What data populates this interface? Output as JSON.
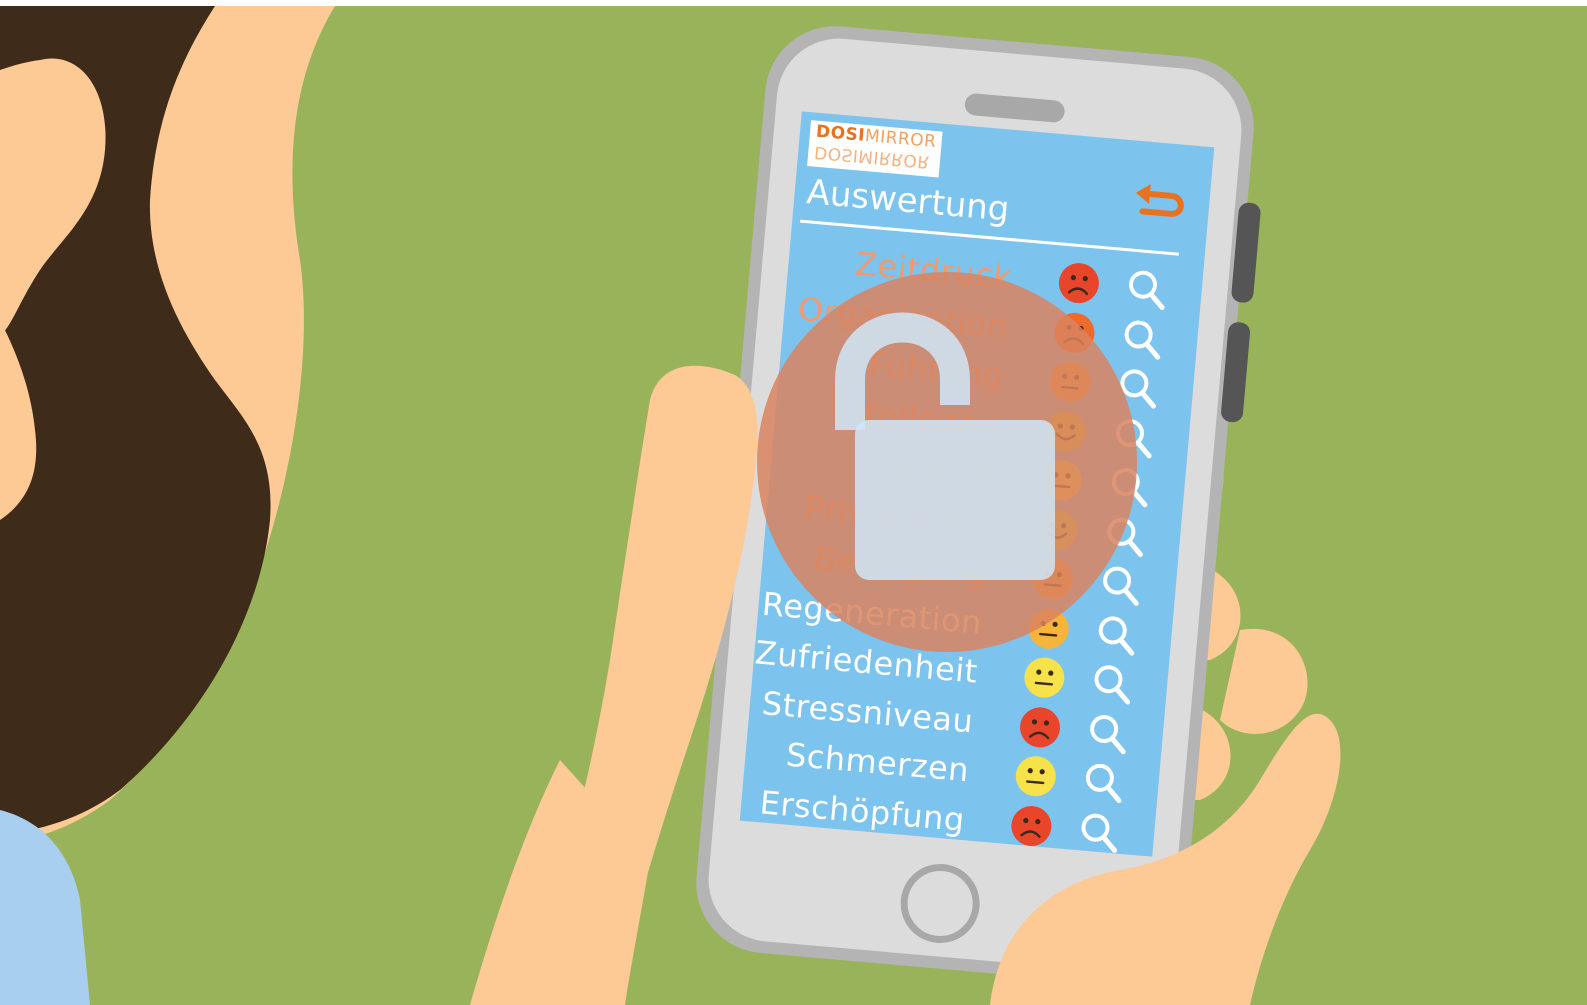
{
  "app": {
    "logo_top_bold": "DOSI",
    "logo_top_light": "MIRROR",
    "logo_bottom": "DOSIMIRROR",
    "title": "Auswertung",
    "back_icon": "undo-arrow-icon"
  },
  "colors": {
    "background_green": "#99b35a",
    "skin": "#fdc995",
    "hair": "#3f2b1a",
    "shirt": "#a8cff0",
    "phone_body": "#dcdcdc",
    "phone_frame": "#b4b4b4",
    "screen": "#7cc3ee",
    "accent_orange": "#e8731e",
    "lock_overlay": "#d9845f"
  },
  "rows": [
    {
      "label": "Zeitdruck",
      "mood": "sad",
      "color": "#e8452a",
      "locked": true
    },
    {
      "label": "Organisation",
      "mood": "sad",
      "color": "#ef6b2b",
      "locked": true
    },
    {
      "label": "Führung",
      "mood": "neutral",
      "color": "#f3a43a",
      "locked": true
    },
    {
      "label": "Kollegen",
      "mood": "happy",
      "color": "#d4c43a",
      "locked": true
    },
    {
      "label": "Kunden",
      "mood": "neutral",
      "color": "#f4d84a",
      "locked": true
    },
    {
      "label": "Privatleben",
      "mood": "happy",
      "color": "#b9d85a",
      "locked": true
    },
    {
      "label": "Bewegung",
      "mood": "neutral",
      "color": "#f3a43a",
      "locked": true
    },
    {
      "label": "Regeneration",
      "mood": "neutral",
      "color": "#f6b53a",
      "locked": false
    },
    {
      "label": "Zufriedenheit",
      "mood": "neutral",
      "color": "#f8e24a",
      "locked": false
    },
    {
      "label": "Stressniveau",
      "mood": "sad",
      "color": "#e8452a",
      "locked": false
    },
    {
      "label": "Schmerzen",
      "mood": "neutral",
      "color": "#f8e24a",
      "locked": false
    },
    {
      "label": "Erschöpfung",
      "mood": "sad",
      "color": "#e8452a",
      "locked": false
    }
  ],
  "icons": {
    "row_action": "magnifier-icon",
    "overlay": "open-padlock-icon"
  }
}
